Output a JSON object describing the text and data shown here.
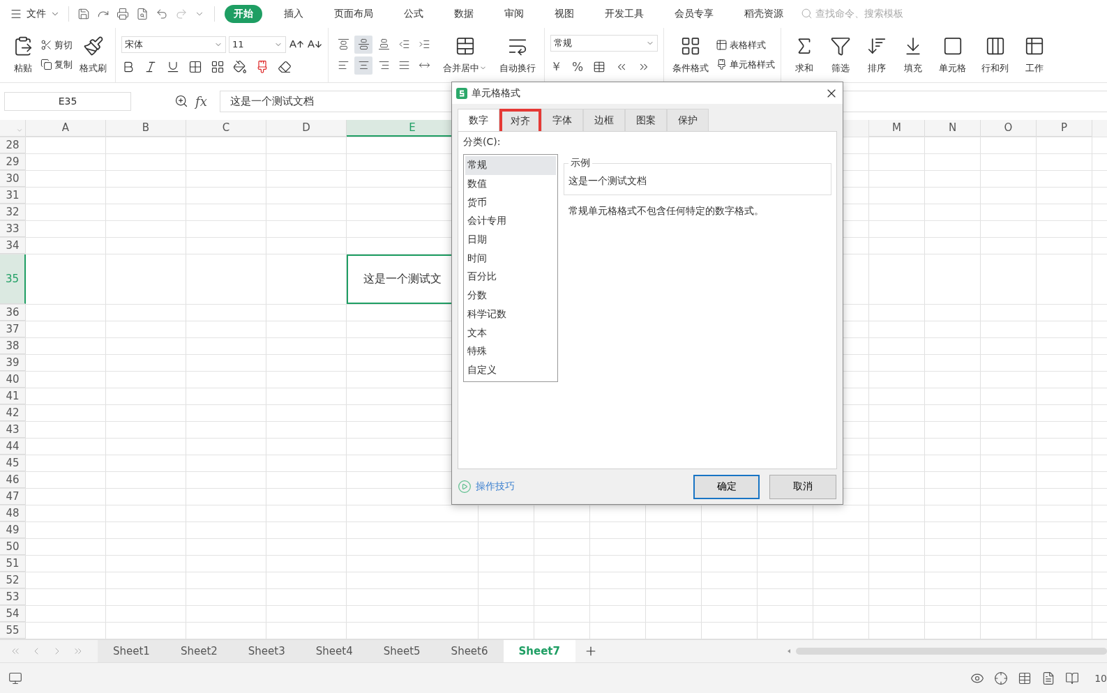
{
  "menu_bar": {
    "file_menu": "文件",
    "tabs": [
      {
        "label": "开始",
        "selected": true
      },
      {
        "label": "插入",
        "selected": false
      },
      {
        "label": "页面布局",
        "selected": false
      },
      {
        "label": "公式",
        "selected": false
      },
      {
        "label": "数据",
        "selected": false
      },
      {
        "label": "审阅",
        "selected": false
      },
      {
        "label": "视图",
        "selected": false
      },
      {
        "label": "开发工具",
        "selected": false
      },
      {
        "label": "会员专享",
        "selected": false
      },
      {
        "label": "稻壳资源",
        "selected": false
      }
    ],
    "search": {
      "placeholder": "查找命令、搜索模板"
    }
  },
  "ribbon": {
    "clipboard": {
      "paste": "粘贴",
      "cut": "剪切",
      "copy": "复制",
      "format_painter": "格式刷"
    },
    "font": {
      "name": "宋体",
      "size": "11"
    },
    "alignment": {
      "buttons": [
        {
          "kind": "top",
          "selected": false
        },
        {
          "kind": "middle",
          "selected": true
        },
        {
          "kind": "bottom",
          "selected": false
        },
        {
          "kind": "outdent",
          "selected": false
        },
        {
          "kind": "indent",
          "selected": false
        },
        {
          "kind": "left",
          "selected": false
        },
        {
          "kind": "center",
          "selected": true
        },
        {
          "kind": "right",
          "selected": false
        },
        {
          "kind": "justify",
          "selected": false
        },
        {
          "kind": "distribute",
          "selected": false
        }
      ],
      "merge": "合并居中",
      "wrap": "自动换行"
    },
    "number": {
      "format": "常规",
      "currency": "￥",
      "percent": "%"
    },
    "styles": {
      "conditional": "条件格式",
      "table_style": "表格样式",
      "cell_style": "单元格样式"
    },
    "editing": [
      {
        "label": "求和",
        "kind": "sum"
      },
      {
        "label": "筛选",
        "kind": "filter"
      },
      {
        "label": "排序",
        "kind": "sort"
      },
      {
        "label": "填充",
        "kind": "fill"
      },
      {
        "label": "单元格",
        "kind": "cell"
      },
      {
        "label": "行和列",
        "kind": "rowcol"
      },
      {
        "label": "工作",
        "kind": "sheet"
      }
    ]
  },
  "formula_bar": {
    "cell_ref": "E35",
    "fx_label": "fx",
    "value": "这是一个测试文档"
  },
  "sheet": {
    "columns": [
      {
        "label": "A",
        "selected": false
      },
      {
        "label": "B",
        "selected": false
      },
      {
        "label": "C",
        "selected": false
      },
      {
        "label": "D",
        "selected": false
      },
      {
        "label": "E",
        "selected": true
      },
      {
        "label": "M",
        "selected": false
      },
      {
        "label": "N",
        "selected": false
      },
      {
        "label": "O",
        "selected": false
      },
      {
        "label": "P",
        "selected": false
      }
    ],
    "rows": [
      {
        "label": "28",
        "selected": false
      },
      {
        "label": "29",
        "selected": false
      },
      {
        "label": "30",
        "selected": false
      },
      {
        "label": "31",
        "selected": false
      },
      {
        "label": "32",
        "selected": false
      },
      {
        "label": "33",
        "selected": false
      },
      {
        "label": "34",
        "selected": false
      },
      {
        "label": "35",
        "selected": true,
        "cells": {
          "E": "这是一个测试文"
        }
      },
      {
        "label": "36",
        "selected": false
      },
      {
        "label": "37",
        "selected": false
      },
      {
        "label": "38",
        "selected": false
      },
      {
        "label": "39",
        "selected": false
      },
      {
        "label": "40",
        "selected": false
      },
      {
        "label": "41",
        "selected": false
      },
      {
        "label": "42",
        "selected": false
      },
      {
        "label": "43",
        "selected": false
      },
      {
        "label": "44",
        "selected": false
      },
      {
        "label": "45",
        "selected": false
      },
      {
        "label": "46",
        "selected": false
      },
      {
        "label": "47",
        "selected": false
      },
      {
        "label": "48",
        "selected": false
      },
      {
        "label": "49",
        "selected": false
      },
      {
        "label": "50",
        "selected": false
      },
      {
        "label": "51",
        "selected": false
      },
      {
        "label": "52",
        "selected": false
      },
      {
        "label": "53",
        "selected": false
      },
      {
        "label": "54",
        "selected": false
      },
      {
        "label": "55",
        "selected": false
      }
    ]
  },
  "sheet_tabs": [
    {
      "label": "Sheet1",
      "selected": false
    },
    {
      "label": "Sheet2",
      "selected": false
    },
    {
      "label": "Sheet3",
      "selected": false
    },
    {
      "label": "Sheet4",
      "selected": false
    },
    {
      "label": "Sheet5",
      "selected": false
    },
    {
      "label": "Sheet6",
      "selected": false
    },
    {
      "label": "Sheet7",
      "selected": true
    }
  ],
  "status_bar": {
    "zoom": "10"
  },
  "dialog": {
    "title": "单元格格式",
    "tabs": [
      {
        "label": "数字",
        "selected": true,
        "annotated": false
      },
      {
        "label": "对齐",
        "selected": false,
        "annotated": true
      },
      {
        "label": "字体",
        "selected": false,
        "annotated": false
      },
      {
        "label": "边框",
        "selected": false,
        "annotated": false
      },
      {
        "label": "图案",
        "selected": false,
        "annotated": false
      },
      {
        "label": "保护",
        "selected": false,
        "annotated": false
      }
    ],
    "category_label": "分类(C):",
    "categories": [
      {
        "label": "常规",
        "selected": true
      },
      {
        "label": "数值",
        "selected": false
      },
      {
        "label": "货币",
        "selected": false
      },
      {
        "label": "会计专用",
        "selected": false
      },
      {
        "label": "日期",
        "selected": false
      },
      {
        "label": "时间",
        "selected": false
      },
      {
        "label": "百分比",
        "selected": false
      },
      {
        "label": "分数",
        "selected": false
      },
      {
        "label": "科学记数",
        "selected": false
      },
      {
        "label": "文本",
        "selected": false
      },
      {
        "label": "特殊",
        "selected": false
      },
      {
        "label": "自定义",
        "selected": false
      }
    ],
    "sample": {
      "legend": "示例",
      "value": "这是一个测试文档"
    },
    "description": "常规单元格格式不包含任何特定的数字格式。",
    "tips_link": "操作技巧",
    "buttons": [
      {
        "label": "确定",
        "kind": "primary"
      },
      {
        "label": "取消",
        "kind": "normal"
      }
    ]
  }
}
